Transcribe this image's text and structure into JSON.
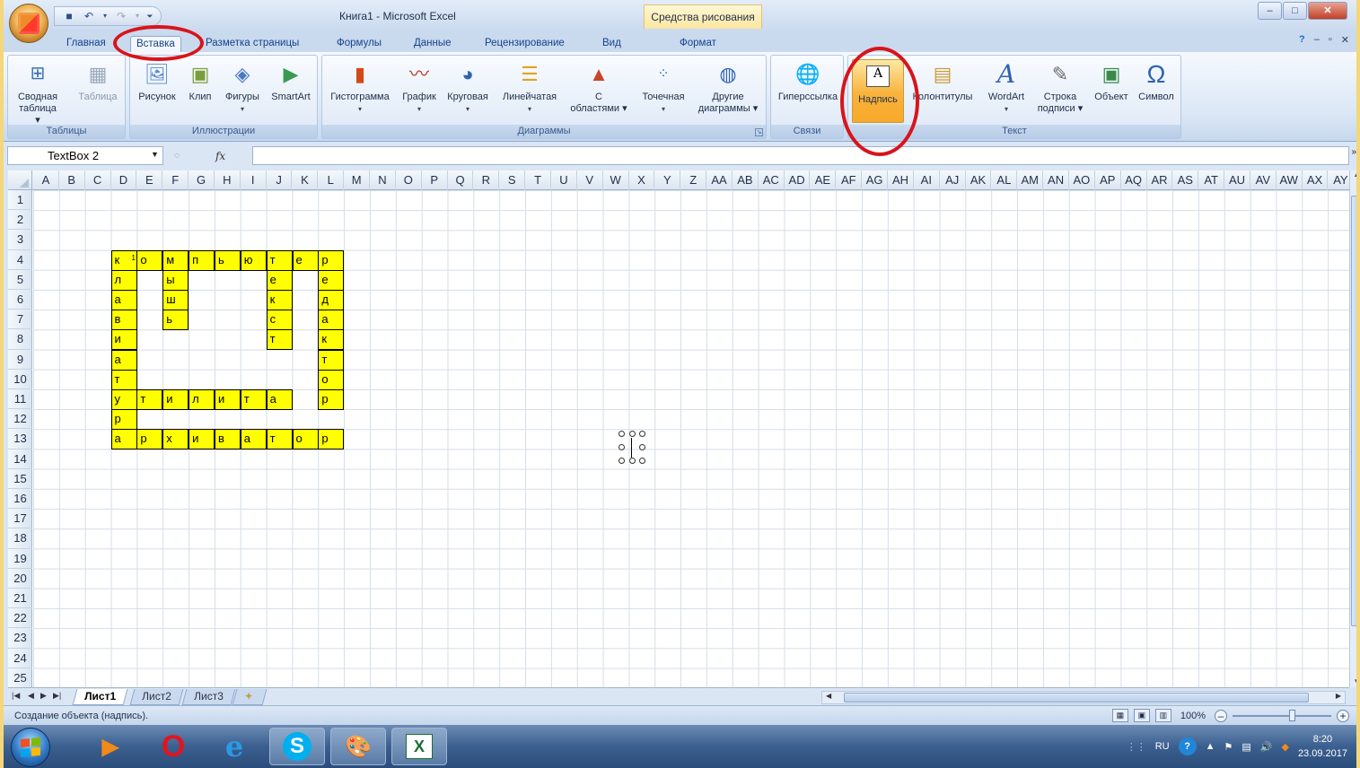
{
  "window": {
    "title": "Книга1 - Microsoft Excel",
    "contextual_tab_group": "Средства рисования",
    "minimize": "–",
    "maximize": "□",
    "close": "✕"
  },
  "ribbon_tabs": [
    {
      "label": "Главная",
      "active": false
    },
    {
      "label": "Вставка",
      "active": true
    },
    {
      "label": "Разметка страницы",
      "active": false
    },
    {
      "label": "Формулы",
      "active": false
    },
    {
      "label": "Данные",
      "active": false
    },
    {
      "label": "Рецензирование",
      "active": false
    },
    {
      "label": "Вид",
      "active": false
    },
    {
      "label": "Формат",
      "active": false
    }
  ],
  "groups": {
    "tables": {
      "label": "Таблицы",
      "buttons": [
        {
          "label": "Сводная",
          "sub": "таблица ▾"
        },
        {
          "label": "Таблица"
        }
      ]
    },
    "illustrations": {
      "label": "Иллюстрации",
      "buttons": [
        {
          "label": "Рисунок"
        },
        {
          "label": "Клип"
        },
        {
          "label": "Фигуры",
          "sub": "▾"
        },
        {
          "label": "SmartArt"
        }
      ]
    },
    "charts": {
      "label": "Диаграммы",
      "buttons": [
        {
          "label": "Гистограмма",
          "sub": "▾"
        },
        {
          "label": "График",
          "sub": "▾"
        },
        {
          "label": "Круговая",
          "sub": "▾"
        },
        {
          "label": "Линейчатая",
          "sub": "▾"
        },
        {
          "label": "С",
          "sub": "областями ▾"
        },
        {
          "label": "Точечная",
          "sub": "▾"
        },
        {
          "label": "Другие",
          "sub": "диаграммы ▾"
        }
      ]
    },
    "links": {
      "label": "Связи",
      "buttons": [
        {
          "label": "Гиперссылка"
        }
      ]
    },
    "text": {
      "label": "Текст",
      "buttons": [
        {
          "label": "Надпись",
          "active": true
        },
        {
          "label": "Колонтитулы"
        },
        {
          "label": "WordArt",
          "sub": "▾"
        },
        {
          "label": "Строка",
          "sub": "подписи ▾"
        },
        {
          "label": "Объект"
        },
        {
          "label": "Символ"
        }
      ]
    }
  },
  "formula_bar": {
    "name_box": "TextBox 2",
    "fx": "fx",
    "formula": ""
  },
  "columns": [
    "A",
    "B",
    "C",
    "D",
    "E",
    "F",
    "G",
    "H",
    "I",
    "J",
    "K",
    "L",
    "M",
    "N",
    "O",
    "P",
    "Q",
    "R",
    "S",
    "T",
    "U",
    "V",
    "W",
    "X",
    "Y",
    "Z",
    "AA",
    "AB",
    "AC",
    "AD",
    "AE",
    "AF",
    "AG",
    "AH",
    "AI",
    "AJ",
    "AK",
    "AL",
    "AM",
    "AN",
    "AO",
    "AP",
    "AQ",
    "AR",
    "AS",
    "AT",
    "AU",
    "AV",
    "AW",
    "AX",
    "AY"
  ],
  "rows": [
    "1",
    "2",
    "3",
    "4",
    "5",
    "6",
    "7",
    "8",
    "9",
    "10",
    "11",
    "12",
    "13",
    "14",
    "15",
    "16",
    "17",
    "18",
    "19",
    "20",
    "21",
    "22",
    "23",
    "24",
    "25"
  ],
  "crossword": {
    "fill_color": "#ffff00",
    "cells": [
      {
        "col": "D",
        "row": 4,
        "text": "к",
        "num": "1"
      },
      {
        "col": "E",
        "row": 4,
        "text": "о"
      },
      {
        "col": "F",
        "row": 4,
        "text": "м"
      },
      {
        "col": "G",
        "row": 4,
        "text": "п"
      },
      {
        "col": "H",
        "row": 4,
        "text": "ь"
      },
      {
        "col": "I",
        "row": 4,
        "text": "ю"
      },
      {
        "col": "J",
        "row": 4,
        "text": "т"
      },
      {
        "col": "K",
        "row": 4,
        "text": "е"
      },
      {
        "col": "L",
        "row": 4,
        "text": "р"
      },
      {
        "col": "D",
        "row": 5,
        "text": "л"
      },
      {
        "col": "F",
        "row": 5,
        "text": "ы"
      },
      {
        "col": "J",
        "row": 5,
        "text": "е"
      },
      {
        "col": "L",
        "row": 5,
        "text": "е"
      },
      {
        "col": "D",
        "row": 6,
        "text": "а"
      },
      {
        "col": "F",
        "row": 6,
        "text": "ш"
      },
      {
        "col": "J",
        "row": 6,
        "text": "к"
      },
      {
        "col": "L",
        "row": 6,
        "text": "д"
      },
      {
        "col": "D",
        "row": 7,
        "text": "в"
      },
      {
        "col": "F",
        "row": 7,
        "text": "ь"
      },
      {
        "col": "J",
        "row": 7,
        "text": "с"
      },
      {
        "col": "L",
        "row": 7,
        "text": "а"
      },
      {
        "col": "D",
        "row": 8,
        "text": "и"
      },
      {
        "col": "J",
        "row": 8,
        "text": "т"
      },
      {
        "col": "L",
        "row": 8,
        "text": "к"
      },
      {
        "col": "D",
        "row": 9,
        "text": "а"
      },
      {
        "col": "L",
        "row": 9,
        "text": "т"
      },
      {
        "col": "D",
        "row": 10,
        "text": "т"
      },
      {
        "col": "L",
        "row": 10,
        "text": "о"
      },
      {
        "col": "D",
        "row": 11,
        "text": "у"
      },
      {
        "col": "E",
        "row": 11,
        "text": "т"
      },
      {
        "col": "F",
        "row": 11,
        "text": "и"
      },
      {
        "col": "G",
        "row": 11,
        "text": "л"
      },
      {
        "col": "H",
        "row": 11,
        "text": "и"
      },
      {
        "col": "I",
        "row": 11,
        "text": "т"
      },
      {
        "col": "J",
        "row": 11,
        "text": "а"
      },
      {
        "col": "L",
        "row": 11,
        "text": "р"
      },
      {
        "col": "D",
        "row": 12,
        "text": "р"
      },
      {
        "col": "D",
        "row": 13,
        "text": "а"
      },
      {
        "col": "E",
        "row": 13,
        "text": "р"
      },
      {
        "col": "F",
        "row": 13,
        "text": "х"
      },
      {
        "col": "G",
        "row": 13,
        "text": "и"
      },
      {
        "col": "H",
        "row": 13,
        "text": "в"
      },
      {
        "col": "I",
        "row": 13,
        "text": "а"
      },
      {
        "col": "J",
        "row": 13,
        "text": "т"
      },
      {
        "col": "K",
        "row": 13,
        "text": "о"
      },
      {
        "col": "L",
        "row": 13,
        "text": "р"
      }
    ]
  },
  "sheets": [
    {
      "label": "Лист1",
      "active": true
    },
    {
      "label": "Лист2",
      "active": false
    },
    {
      "label": "Лист3",
      "active": false
    }
  ],
  "status": {
    "text": "Создание объекта (надпись).",
    "zoom": "100%"
  },
  "tray": {
    "lang": "RU",
    "time": "8:20",
    "date": "23.09.2017"
  },
  "annotation_color": "#d8141c"
}
